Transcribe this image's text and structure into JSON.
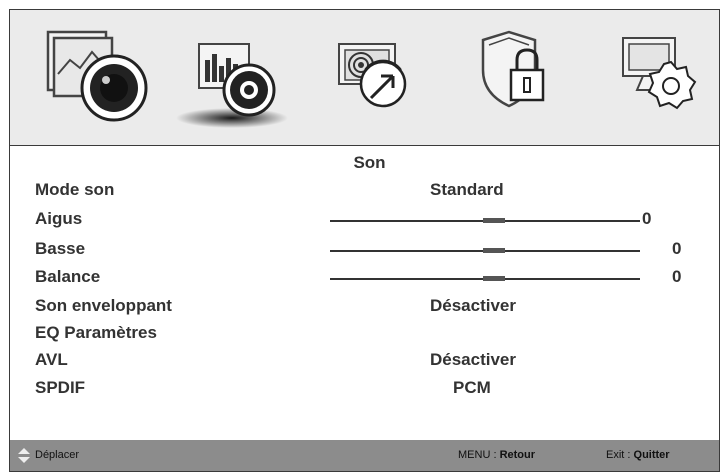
{
  "tabs": [
    {
      "id": "picture",
      "icon": "picture-icon",
      "selected": false
    },
    {
      "id": "sound",
      "icon": "sound-icon",
      "selected": true
    },
    {
      "id": "channel",
      "icon": "channel-icon",
      "selected": false
    },
    {
      "id": "lock",
      "icon": "lock-icon",
      "selected": false
    },
    {
      "id": "setup",
      "icon": "setup-icon",
      "selected": false
    }
  ],
  "menu": {
    "title": "Son",
    "items": [
      {
        "label": "Mode son",
        "value": "Standard"
      },
      {
        "label": "Aigus",
        "value": "0",
        "slider": 0.5
      },
      {
        "label": "Basse",
        "value": "0",
        "slider": 0.5
      },
      {
        "label": "Balance",
        "value": "0",
        "slider": 0.5
      },
      {
        "label": "Son enveloppant",
        "value": "Désactiver"
      },
      {
        "label": "EQ Paramètres",
        "value": ""
      },
      {
        "label": "AVL",
        "value": "Désactiver"
      },
      {
        "label": "SPDIF",
        "value": "PCM"
      }
    ]
  },
  "footer": {
    "move_label": "Déplacer",
    "menu_key": "MENU : ",
    "menu_action": "Retour",
    "exit_key": "Exit : ",
    "exit_action": "Quitter"
  },
  "colors": {
    "panel": "#ebebeb",
    "footer": "#8c8c8c",
    "text": "#333333"
  }
}
